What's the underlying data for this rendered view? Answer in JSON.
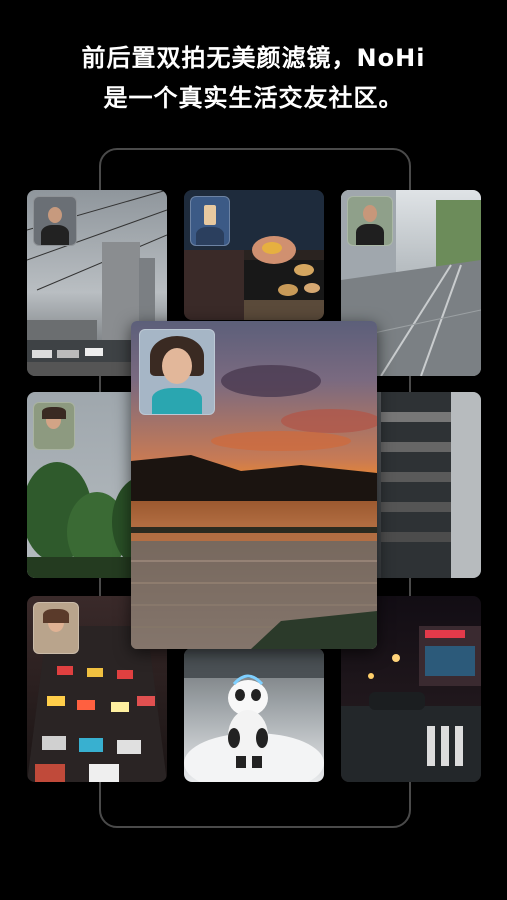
{
  "headline": {
    "line1": "前后置双拍无美颜滤镜，NoHi",
    "line2": "是一个真实生活交友社区。"
  },
  "colors": {
    "background": "#000000",
    "frame": "#4a4a4a",
    "sunset_orange": "#f08a2a",
    "text": "#ffffff"
  }
}
